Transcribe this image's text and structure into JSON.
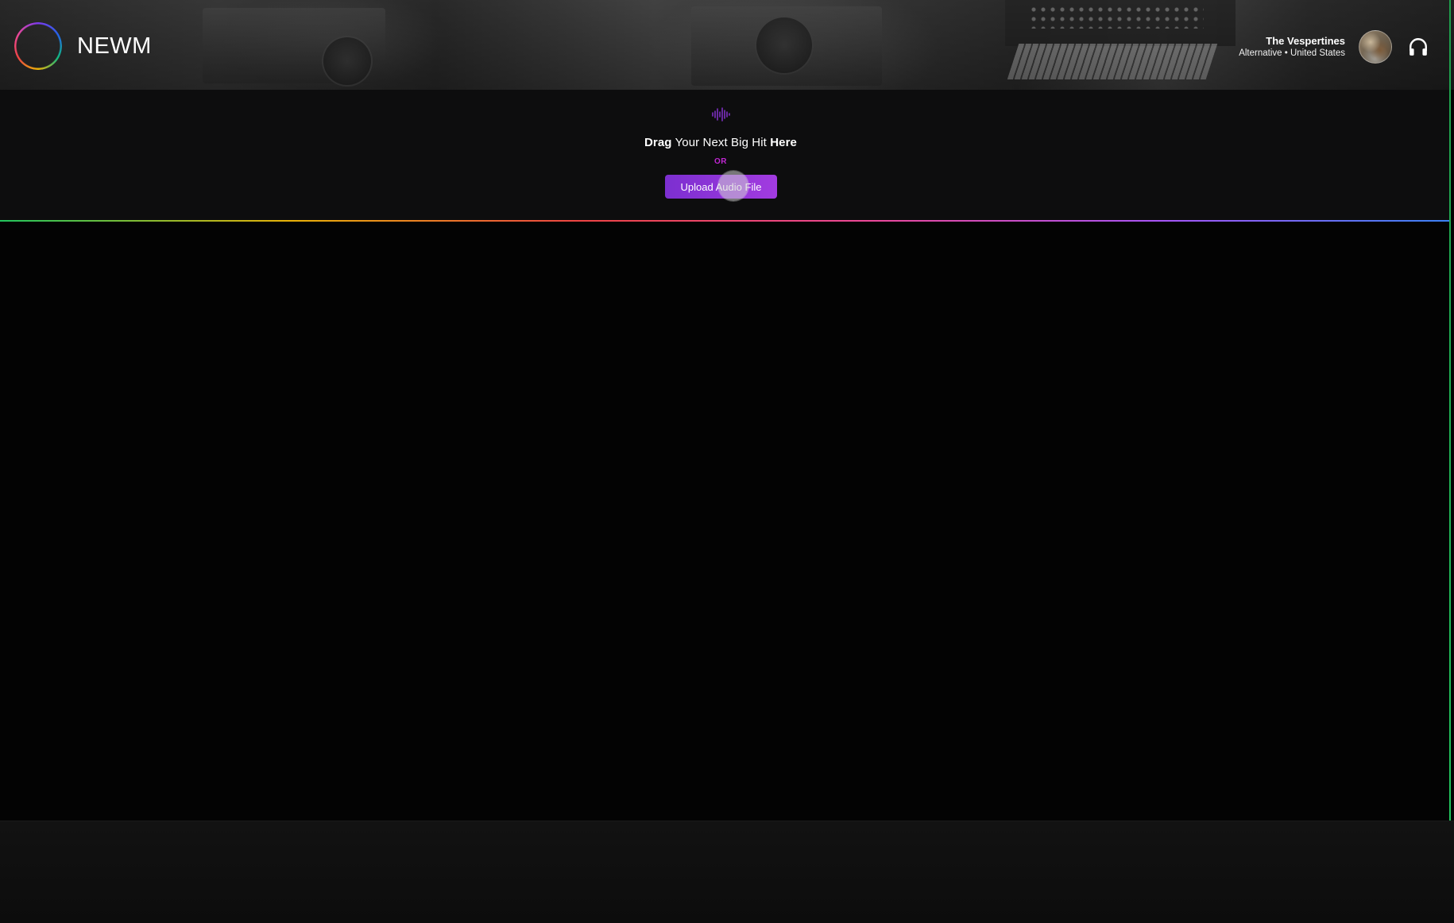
{
  "app": {
    "brand": "NEWM"
  },
  "profile": {
    "name": "The Vespertines",
    "meta": "Alternative • United States"
  },
  "icons": {
    "logo": "newm-ring-logo",
    "audio": "audio-wave-icon",
    "listen": "headphones-icon",
    "avatar": "artist-avatar"
  },
  "upload": {
    "drag_word": "Drag",
    "middle_text": " Your Next Big Hit ",
    "here_word": "Here",
    "or_text": "OR",
    "button_label": "Upload Audio File"
  },
  "colors": {
    "accent_purple": "#8b33d6",
    "or_magenta": "#c026d3",
    "background": "#030303",
    "edge_green": "#22c55e"
  }
}
